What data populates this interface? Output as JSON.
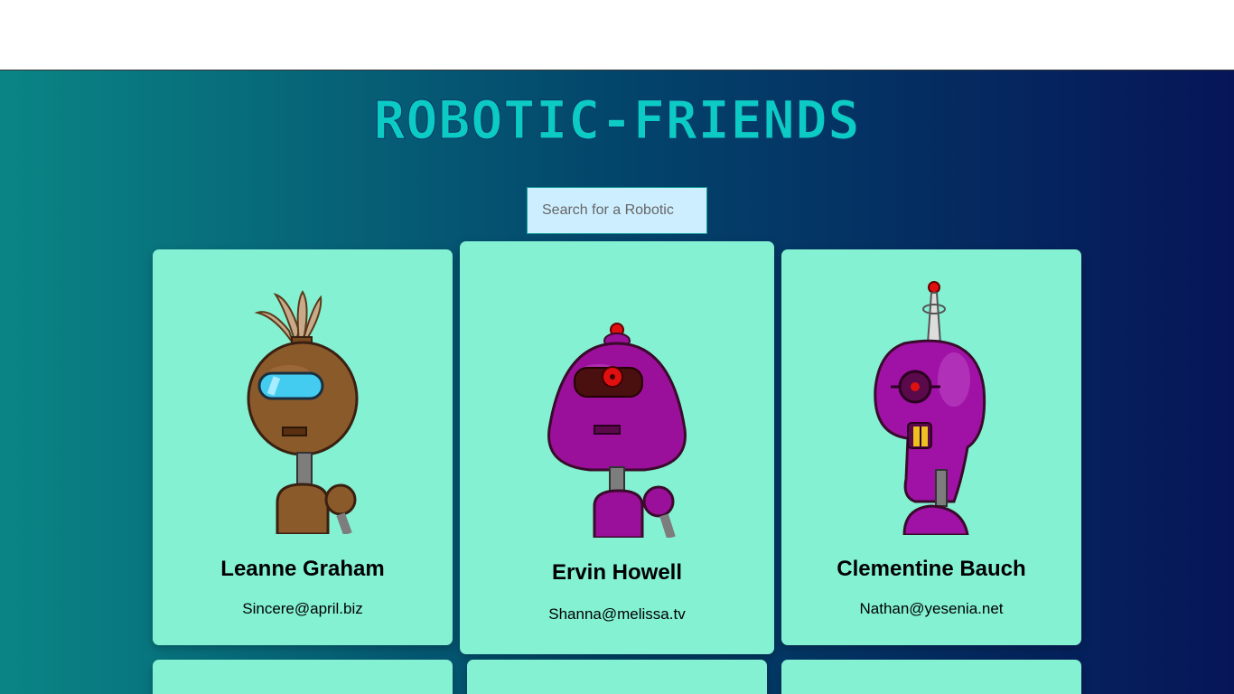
{
  "app": {
    "title": "ROBOTIC-FRIENDS"
  },
  "search": {
    "placeholder": "Search for a Robotic",
    "value": ""
  },
  "robots": [
    {
      "name": "Leanne Graham",
      "email": "Sincere@april.biz",
      "robot_icon": "brown-robot-icon",
      "color": "#8b5a2b"
    },
    {
      "name": "Ervin Howell",
      "email": "Shanna@melissa.tv",
      "robot_icon": "purple-dome-robot-icon",
      "color": "#9b109b"
    },
    {
      "name": "Clementine Bauch",
      "email": "Nathan@yesenia.net",
      "robot_icon": "purple-antenna-robot-icon",
      "color": "#a012a6"
    }
  ],
  "colors": {
    "card": "#84f1d3",
    "title": "#0ccac4",
    "search_bg": "#cdeeff"
  }
}
